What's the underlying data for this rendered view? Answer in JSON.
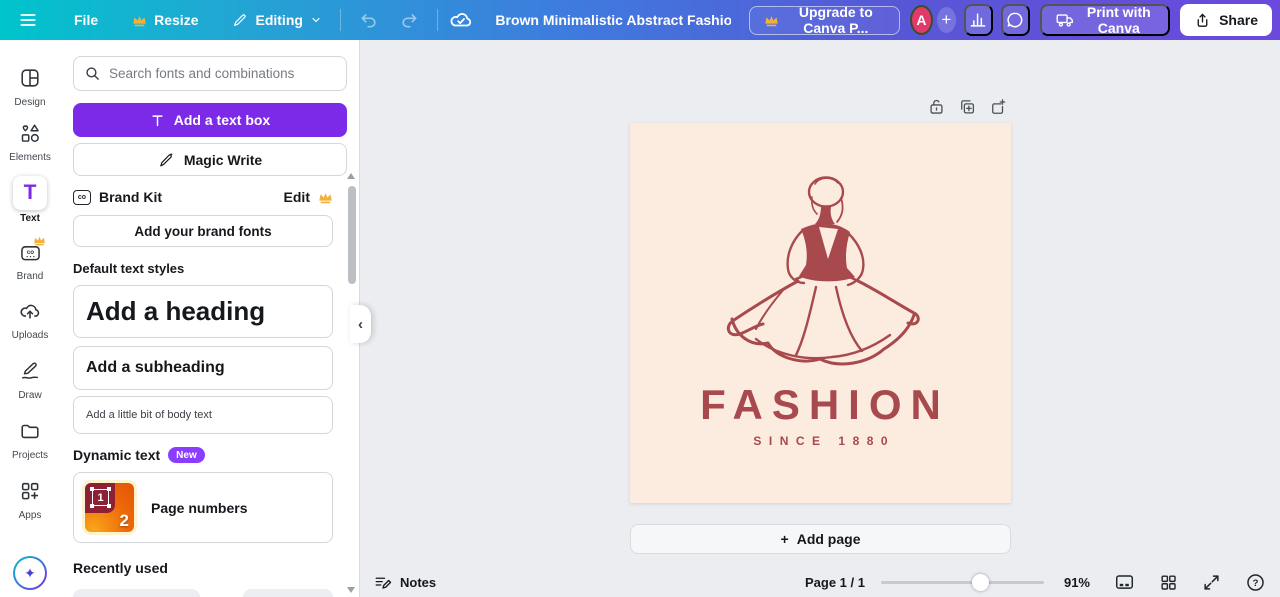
{
  "topbar": {
    "file_label": "File",
    "resize_label": "Resize",
    "editing_label": "Editing",
    "doc_title": "Brown Minimalistic Abstract Fashion Brand Lo...",
    "upgrade_label": "Upgrade to Canva P...",
    "avatar_letter": "A",
    "print_label": "Print with Canva",
    "share_label": "Share"
  },
  "rail": {
    "items": [
      {
        "label": "Design"
      },
      {
        "label": "Elements"
      },
      {
        "label": "Text"
      },
      {
        "label": "Brand"
      },
      {
        "label": "Uploads"
      },
      {
        "label": "Draw"
      },
      {
        "label": "Projects"
      },
      {
        "label": "Apps"
      }
    ],
    "active_item": "Text"
  },
  "panel": {
    "search_placeholder": "Search fonts and combinations",
    "add_text_box_label": "Add a text box",
    "magic_write_label": "Magic Write",
    "brand_kit_label": "Brand Kit",
    "edit_label": "Edit",
    "add_brand_fonts_label": "Add your brand fonts",
    "default_text_styles_label": "Default text styles",
    "heading_label": "Add a heading",
    "subheading_label": "Add a subheading",
    "body_text_label": "Add a little bit of body text",
    "dynamic_text_label": "Dynamic text",
    "new_badge": "New",
    "page_numbers_label": "Page numbers",
    "page_number_icon_1": "1",
    "page_number_icon_2": "2",
    "recently_used_label": "Recently used"
  },
  "canvas": {
    "logo_title": "FASHION",
    "logo_subtitle": "SINCE 1880",
    "add_page_label": "Add page"
  },
  "statusbar": {
    "notes_label": "Notes",
    "page_indicator": "Page 1 / 1",
    "zoom_percent": "91%"
  },
  "glyphs": {
    "plus": "+",
    "chevron_left": "‹",
    "question": "?",
    "sparkle": "✦",
    "t_letter": "T",
    "co_label": "co",
    "co_dots": "···"
  },
  "colors": {
    "topbar_gradient_start": "#00c4cc",
    "topbar_gradient_mid": "#3f7ade",
    "topbar_gradient_end": "#6b49dd",
    "canva_purple": "#7d2ae8",
    "badge_purple": "#8b3dff",
    "workspace_bg": "#ebedf0",
    "page_bg": "#fcebdf",
    "logo_color": "#a8494d",
    "accent_gold": "#f2b13d",
    "avatar_pink": "#e2396b"
  }
}
